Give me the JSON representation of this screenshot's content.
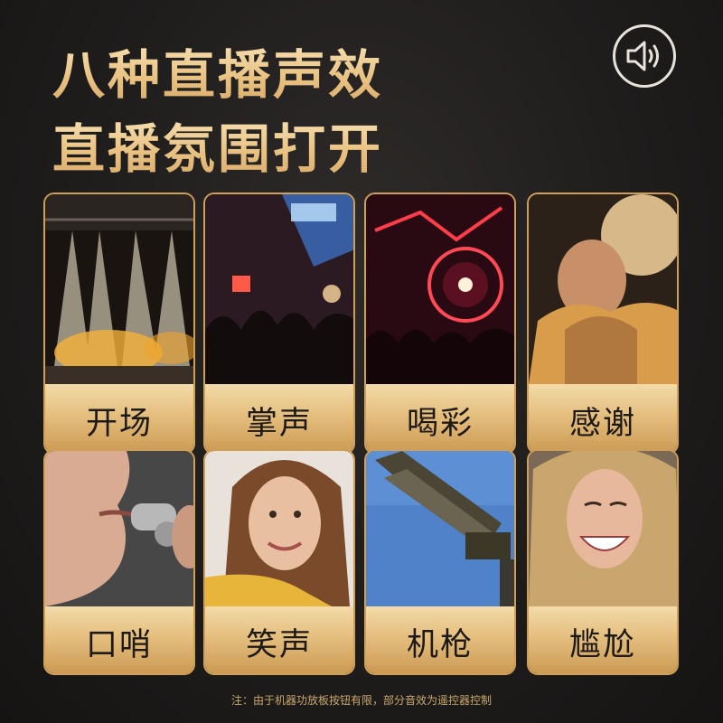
{
  "header": {
    "line1": "八种直播声效",
    "line2": "直播氛围打开",
    "icon": "speaker-icon"
  },
  "effects": [
    {
      "label": "开场"
    },
    {
      "label": "掌声"
    },
    {
      "label": "喝彩"
    },
    {
      "label": "感谢"
    },
    {
      "label": "口哨"
    },
    {
      "label": "笑声"
    },
    {
      "label": "机枪"
    },
    {
      "label": "尴尬"
    }
  ],
  "footnote": "注：由于机器功放板按钮有限，部分音效为遥控器控制",
  "colors": {
    "background": "#1f1d1c",
    "gold_text": "#f2d49d",
    "label_gold": "#e4bd7d",
    "card_border": "#cf9f58",
    "footnote": "#c9a86d"
  }
}
